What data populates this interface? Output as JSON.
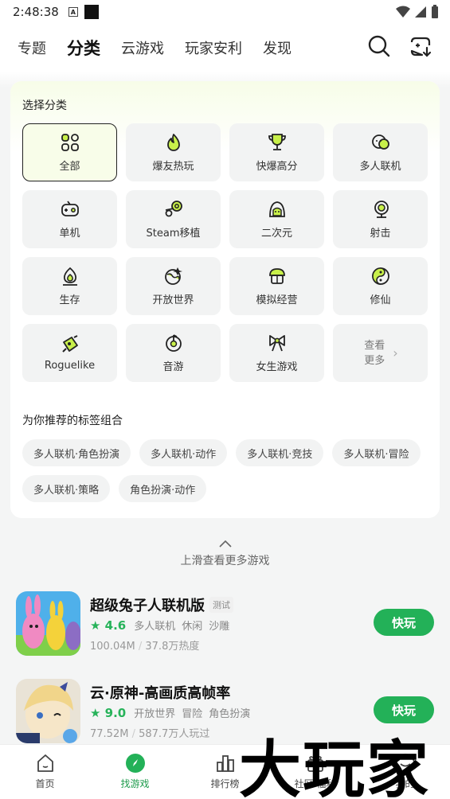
{
  "status": {
    "time": "2:48:38"
  },
  "nav": {
    "tabs": [
      {
        "label": "专题"
      },
      {
        "label": "分类"
      },
      {
        "label": "云游戏"
      },
      {
        "label": "玩家安利"
      },
      {
        "label": "发现"
      }
    ]
  },
  "categories": {
    "title": "选择分类",
    "items": [
      {
        "label": "全部"
      },
      {
        "label": "爆友热玩"
      },
      {
        "label": "快爆高分"
      },
      {
        "label": "多人联机"
      },
      {
        "label": "单机"
      },
      {
        "label": "Steam移植"
      },
      {
        "label": "二次元"
      },
      {
        "label": "射击"
      },
      {
        "label": "生存"
      },
      {
        "label": "开放世界"
      },
      {
        "label": "模拟经营"
      },
      {
        "label": "修仙"
      },
      {
        "label": "Roguelike"
      },
      {
        "label": "音游"
      },
      {
        "label": "女生游戏"
      }
    ],
    "more_label": "查看更多"
  },
  "recommend": {
    "title": "为你推荐的标签组合",
    "tags": [
      "多人联机·角色扮演",
      "多人联机·动作",
      "多人联机·竞技",
      "多人联机·冒险",
      "多人联机·策略",
      "角色扮演·动作"
    ]
  },
  "swipe_hint": "上滑查看更多游戏",
  "games": [
    {
      "name": "超级兔子人联机版",
      "badge": "测试",
      "score": "4.6",
      "tags": [
        "多人联机",
        "休闲",
        "沙雕"
      ],
      "size": "100.04M",
      "sep": "/",
      "popularity": "37.8万热度",
      "play": "快玩"
    },
    {
      "name": "云·原神-高画质高帧率",
      "badge": "",
      "score": "9.0",
      "tags": [
        "开放世界",
        "冒险",
        "角色扮演"
      ],
      "size": "77.52M",
      "sep": "/",
      "popularity": "587.7万人玩过",
      "play": "快玩"
    }
  ],
  "bottom_nav": [
    {
      "label": "首页"
    },
    {
      "label": "找游戏"
    },
    {
      "label": "排行榜"
    },
    {
      "label": "社区·福利"
    },
    {
      "label": "我的"
    }
  ],
  "watermark": "大玩家",
  "colors": {
    "accent": "#23b158",
    "highlight": "#a8e63d"
  }
}
